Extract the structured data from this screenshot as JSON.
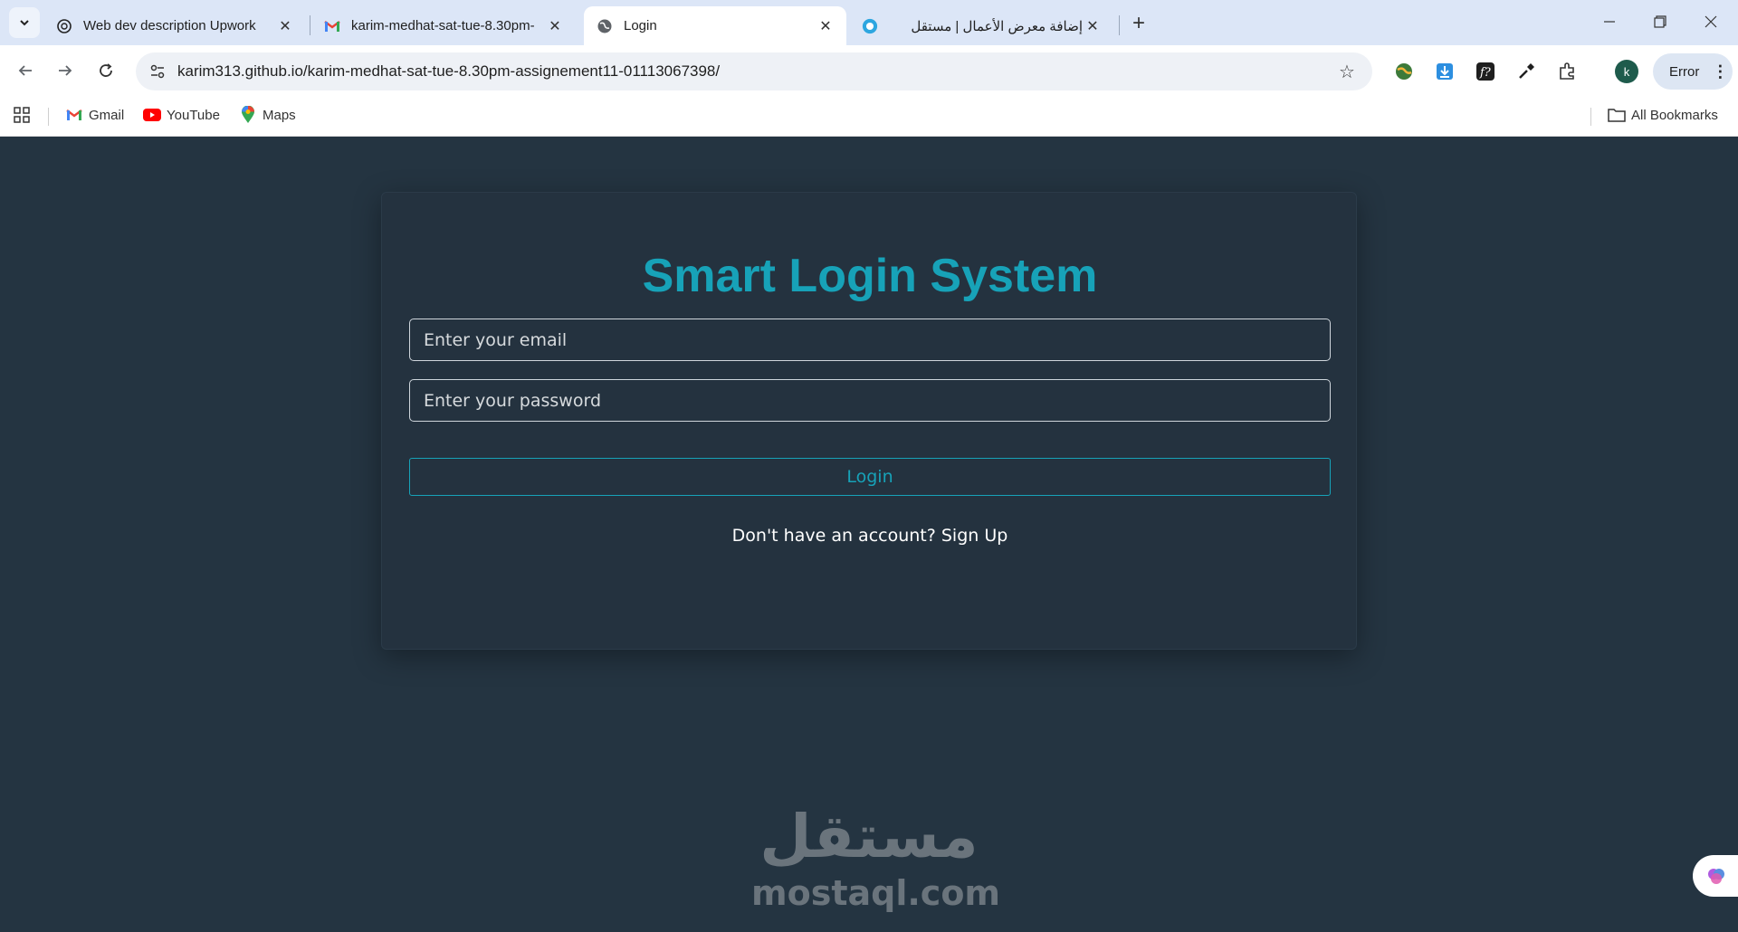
{
  "browser": {
    "tabs": [
      {
        "title": "Web dev description Upwork",
        "icon": "chatgpt-icon"
      },
      {
        "title": "karim-medhat-sat-tue-8.30pm-",
        "icon": "gmail-icon"
      },
      {
        "title": "Login",
        "icon": "globe-icon",
        "active": true
      },
      {
        "title": "إضافة معرض الأعمال | مستقل",
        "icon": "mostaql-icon"
      }
    ],
    "url": "karim313.github.io/karim-medhat-sat-tue-8.30pm-assignement11-01113067398/",
    "profile_initial": "k",
    "error_label": "Error",
    "bookmarks": [
      {
        "label": "Gmail",
        "icon": "gmail-icon"
      },
      {
        "label": "YouTube",
        "icon": "youtube-icon"
      },
      {
        "label": "Maps",
        "icon": "maps-icon"
      }
    ],
    "all_bookmarks_label": "All Bookmarks"
  },
  "page": {
    "title": "Smart Login System",
    "email_placeholder": "Enter your email",
    "password_placeholder": "Enter your password",
    "login_label": "Login",
    "signup_prompt": "Don't have an account?",
    "signup_link": "Sign Up"
  },
  "watermark": {
    "arabic": "مستقل",
    "latin": "mostaql.com"
  },
  "colors": {
    "page_bg": "#243441",
    "accent": "#17a2b8",
    "tabstrip_bg": "#dce6f7"
  }
}
